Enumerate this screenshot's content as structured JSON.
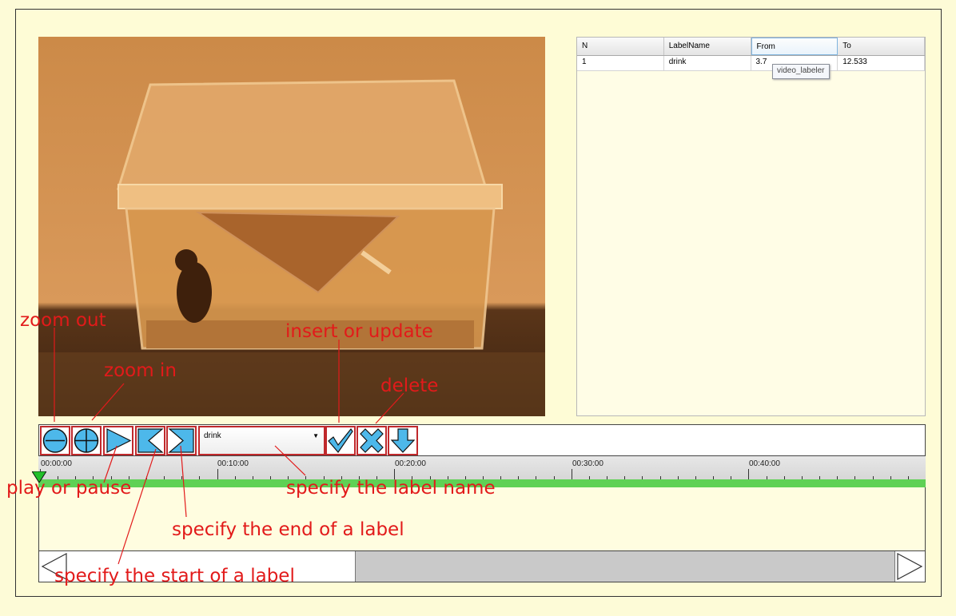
{
  "table": {
    "columns": [
      "N",
      "LabelName",
      "From",
      "To"
    ],
    "rows": [
      {
        "n": "1",
        "label": "drink",
        "from": "3.7",
        "to": "12.533"
      }
    ],
    "tooltip": "video_labeler"
  },
  "toolbar": {
    "buttons": [
      "zoom-out-icon",
      "zoom-in-icon",
      "play-icon",
      "set-start-icon",
      "set-end-icon",
      "checkmark-icon",
      "delete-x-icon",
      "down-arrow-icon"
    ],
    "label_select": {
      "value": "drink"
    }
  },
  "timeline": {
    "ticks": [
      "00:00:00",
      "00:10:00",
      "00:20:00",
      "00:30:00",
      "00:40:00"
    ],
    "progress_color": "#5fd155",
    "scroll_thumb_fraction": 0.61
  },
  "annotations": {
    "zoom_out": "zoom out",
    "zoom_in": "zoom in",
    "insert_update": "insert or update",
    "delete": "delete",
    "play_pause": "play or pause",
    "label_name": "specify the label name",
    "end_label": "specify the end of a label",
    "start_label": "specify the start of a label"
  },
  "colors": {
    "background": "#fdfbd7",
    "annotation": "#e21a1a",
    "button_border": "#c0292c",
    "icon_fill": "#4db8ea"
  }
}
